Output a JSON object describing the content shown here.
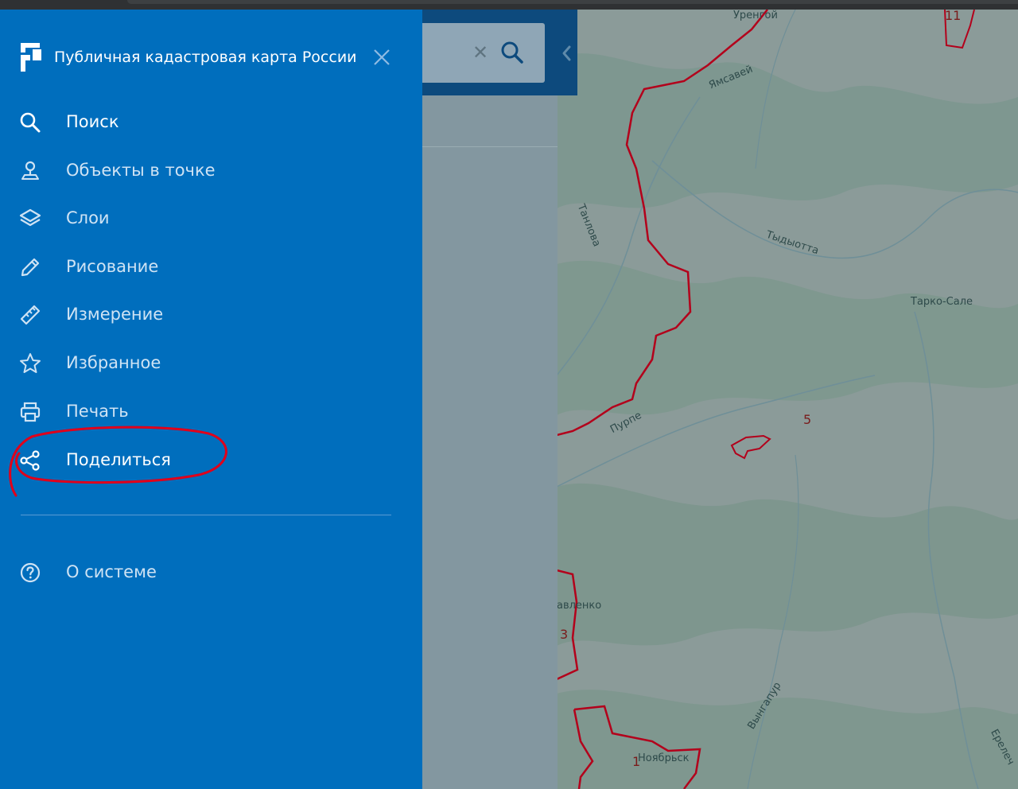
{
  "app": {
    "title": "Публичная кадастровая карта России",
    "logo_icon": "rosreestr-logo-icon",
    "close_icon": "close-icon"
  },
  "menu": {
    "items": [
      {
        "label": "Поиск",
        "icon": "search-icon"
      },
      {
        "label": "Объекты в точке",
        "icon": "location-pin-icon"
      },
      {
        "label": "Слои",
        "icon": "layers-icon"
      },
      {
        "label": "Рисование",
        "icon": "pencil-icon"
      },
      {
        "label": "Измерение",
        "icon": "ruler-icon"
      },
      {
        "label": "Избранное",
        "icon": "star-icon"
      },
      {
        "label": "Печать",
        "icon": "printer-icon"
      },
      {
        "label": "Поделиться",
        "icon": "share-icon"
      }
    ],
    "footer_items": [
      {
        "label": "О системе",
        "icon": "help-circle-icon"
      }
    ]
  },
  "search": {
    "value": "",
    "clear_icon": "clear-icon",
    "button_icon": "search-icon"
  },
  "map": {
    "place_labels": [
      "Уренгой",
      "Ямсавей",
      "Танлова",
      "Тыдыотта",
      "Тарко-Сале",
      "Пурпе",
      "авленко",
      "Вынгапур",
      "Ноябрьск",
      "Ерелеч"
    ],
    "area_numbers": [
      "11",
      "5",
      "3",
      "1"
    ]
  },
  "colors": {
    "sidebar": "#006ebd",
    "panel_header": "#0d4a7d",
    "border_red": "#b3001b",
    "annotation": "#e0001b"
  }
}
